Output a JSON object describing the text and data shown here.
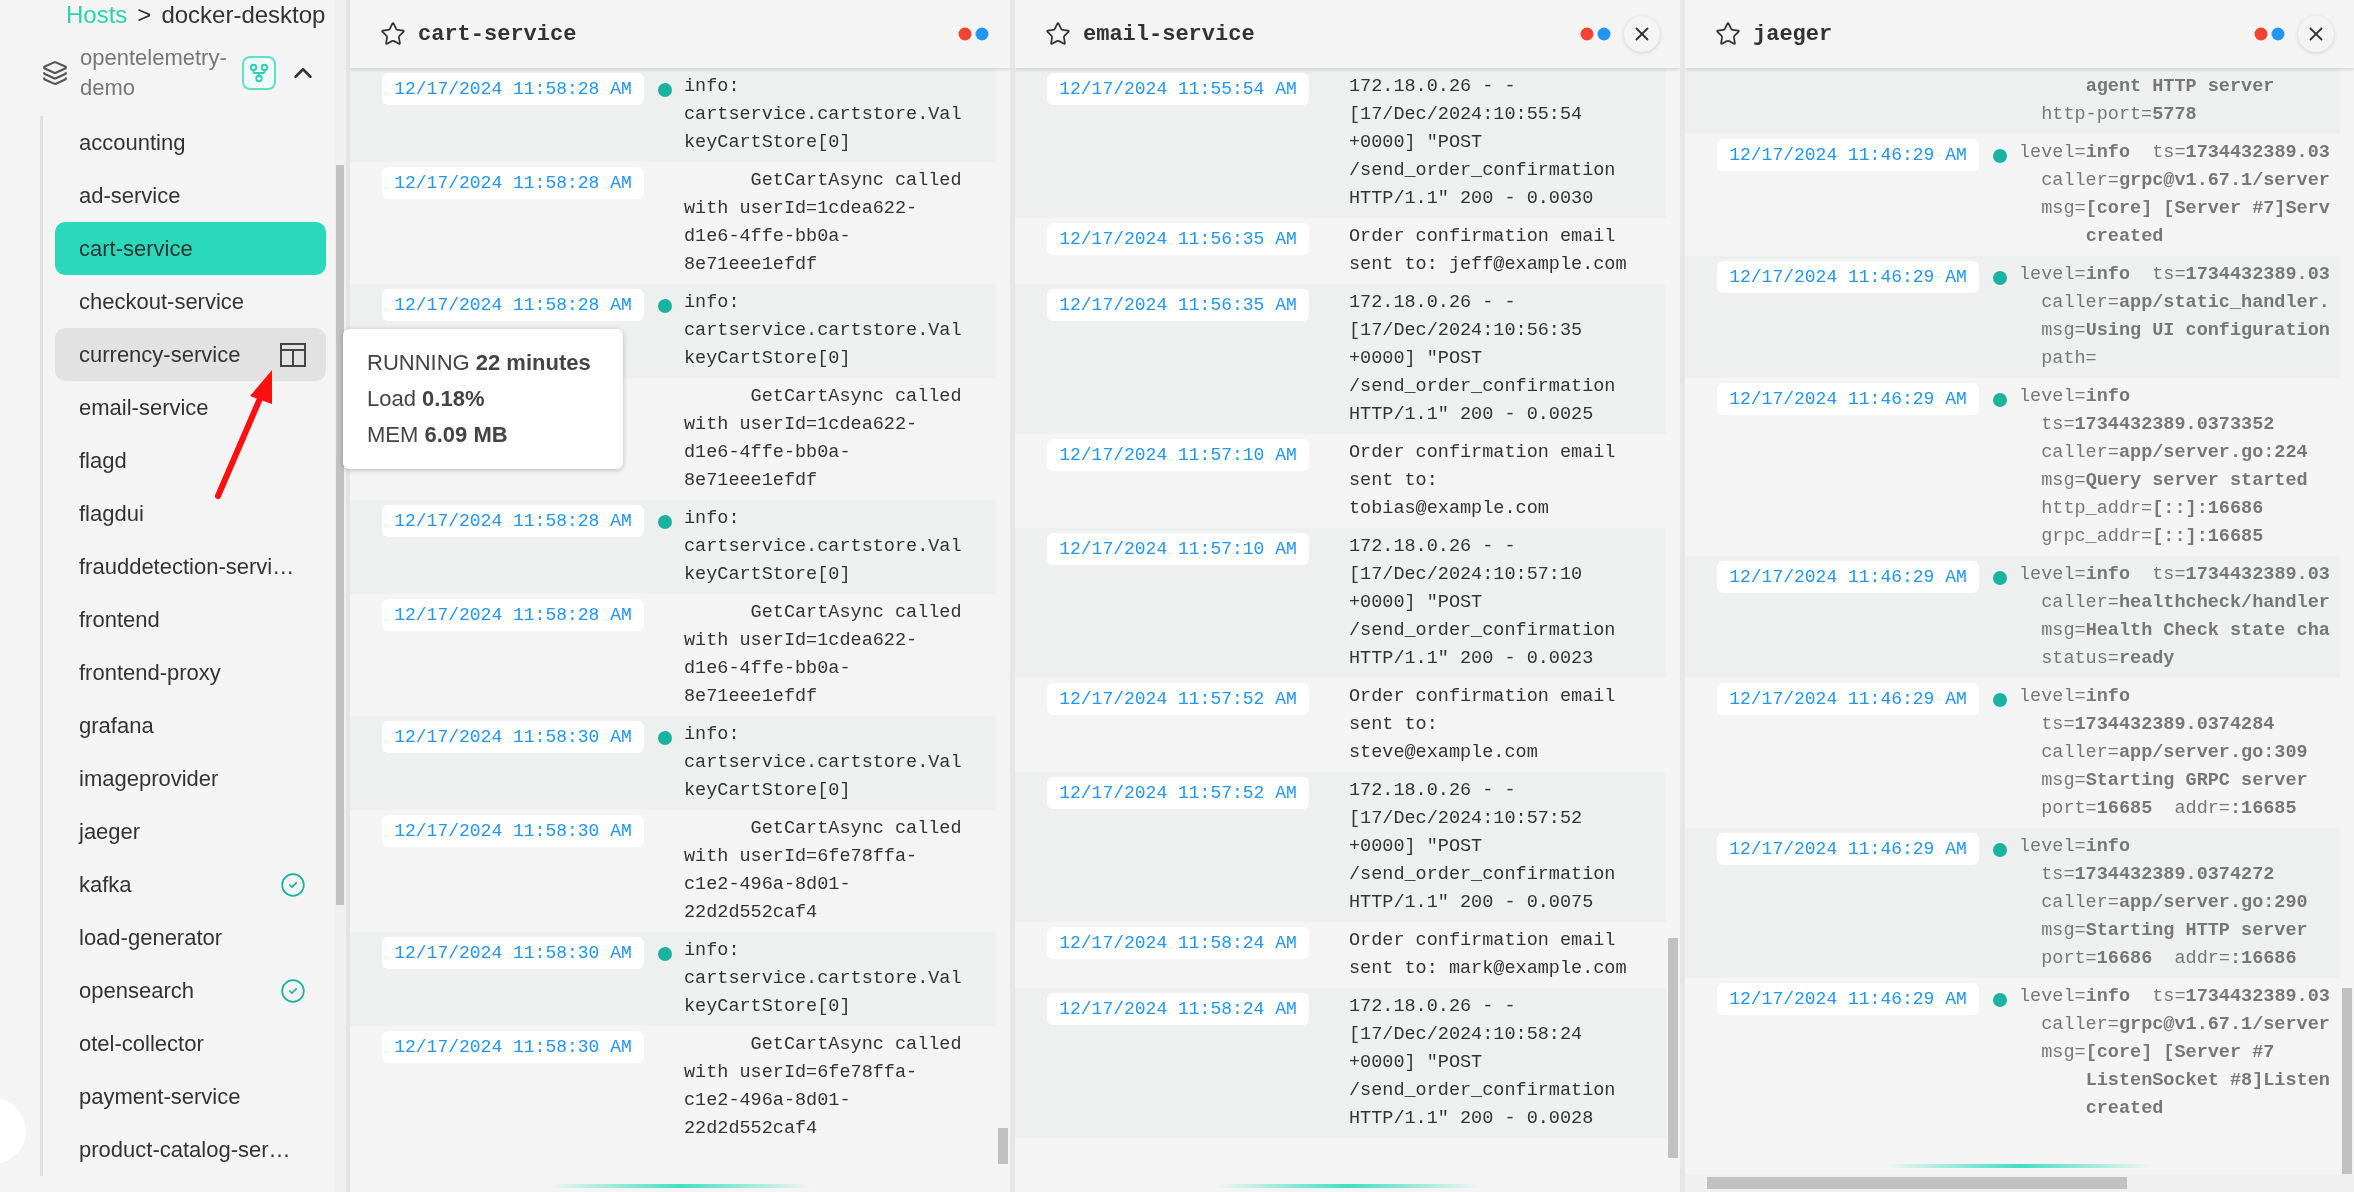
{
  "breadcrumb": {
    "root": "Hosts",
    "separator": ">",
    "current": "docker-desktop"
  },
  "group": {
    "name": "opentelemetry-demo",
    "expanded": true
  },
  "sidebar": {
    "items": [
      {
        "label": "accounting",
        "selected": false,
        "hovered": false,
        "check": false
      },
      {
        "label": "ad-service",
        "selected": false,
        "hovered": false,
        "check": false
      },
      {
        "label": "cart-service",
        "selected": true,
        "hovered": false,
        "check": false
      },
      {
        "label": "checkout-service",
        "selected": false,
        "hovered": false,
        "check": false
      },
      {
        "label": "currency-service",
        "selected": false,
        "hovered": true,
        "check": false
      },
      {
        "label": "email-service",
        "selected": false,
        "hovered": false,
        "check": false
      },
      {
        "label": "flagd",
        "selected": false,
        "hovered": false,
        "check": false
      },
      {
        "label": "flagdui",
        "selected": false,
        "hovered": false,
        "check": false
      },
      {
        "label": "frauddetection-servi…",
        "selected": false,
        "hovered": false,
        "check": false
      },
      {
        "label": "frontend",
        "selected": false,
        "hovered": false,
        "check": false
      },
      {
        "label": "frontend-proxy",
        "selected": false,
        "hovered": false,
        "check": false
      },
      {
        "label": "grafana",
        "selected": false,
        "hovered": false,
        "check": false
      },
      {
        "label": "imageprovider",
        "selected": false,
        "hovered": false,
        "check": false
      },
      {
        "label": "jaeger",
        "selected": false,
        "hovered": false,
        "check": false
      },
      {
        "label": "kafka",
        "selected": false,
        "hovered": false,
        "check": true
      },
      {
        "label": "load-generator",
        "selected": false,
        "hovered": false,
        "check": false
      },
      {
        "label": "opensearch",
        "selected": false,
        "hovered": false,
        "check": true
      },
      {
        "label": "otel-collector",
        "selected": false,
        "hovered": false,
        "check": false
      },
      {
        "label": "payment-service",
        "selected": false,
        "hovered": false,
        "check": false
      },
      {
        "label": "product-catalog-ser…",
        "selected": false,
        "hovered": false,
        "check": false
      }
    ]
  },
  "tooltip": {
    "lines": [
      "RUNNING **22 minutes**",
      "Load **0.18%**",
      "MEM **6.09 MB**"
    ]
  },
  "panels": [
    {
      "title": "cart-service",
      "closable": false,
      "kind": "plain",
      "entries": [
        {
          "time": "12/17/2024 11:58:28 AM",
          "dot": true,
          "lines": [
            "info:",
            "cartservice.cartstore.Val",
            "keyCartStore[0]"
          ]
        },
        {
          "time": "12/17/2024 11:58:28 AM",
          "dot": false,
          "lines": [
            "      GetCartAsync called",
            "with userId=1cdea622-",
            "d1e6-4ffe-bb0a-",
            "8e71eee1efdf"
          ]
        },
        {
          "time": "12/17/2024 11:58:28 AM",
          "dot": true,
          "lines": [
            "info:",
            "cartservice.cartstore.Val",
            "keyCartStore[0]"
          ]
        },
        {
          "dot": false,
          "lines": [
            "      GetCartAsync called",
            "with userId=1cdea622-",
            "d1e6-4ffe-bb0a-",
            "8e71eee1efdf"
          ]
        },
        {
          "time": "12/17/2024 11:58:28 AM",
          "dot": true,
          "lines": [
            "info:",
            "cartservice.cartstore.Val",
            "keyCartStore[0]"
          ]
        },
        {
          "time": "12/17/2024 11:58:28 AM",
          "dot": false,
          "lines": [
            "      GetCartAsync called",
            "with userId=1cdea622-",
            "d1e6-4ffe-bb0a-",
            "8e71eee1efdf"
          ]
        },
        {
          "time": "12/17/2024 11:58:30 AM",
          "dot": true,
          "lines": [
            "info:",
            "cartservice.cartstore.Val",
            "keyCartStore[0]"
          ]
        },
        {
          "time": "12/17/2024 11:58:30 AM",
          "dot": false,
          "lines": [
            "      GetCartAsync called",
            "with userId=6fe78ffa-",
            "c1e2-496a-8d01-",
            "22d2d552caf4"
          ]
        },
        {
          "time": "12/17/2024 11:58:30 AM",
          "dot": true,
          "lines": [
            "info:",
            "cartservice.cartstore.Val",
            "keyCartStore[0]"
          ]
        },
        {
          "time": "12/17/2024 11:58:30 AM",
          "dot": false,
          "lines": [
            "      GetCartAsync called",
            "with userId=6fe78ffa-",
            "c1e2-496a-8d01-",
            "22d2d552caf4"
          ]
        }
      ]
    },
    {
      "title": "email-service",
      "closable": true,
      "kind": "plain",
      "entries": [
        {
          "time": "12/17/2024 11:55:54 AM",
          "dot": false,
          "lines": [
            "172.18.0.26 - -",
            "[17/Dec/2024:10:55:54",
            "+0000] \"POST",
            "/send_order_confirmation",
            "HTTP/1.1\" 200 - 0.0030"
          ]
        },
        {
          "time": "12/17/2024 11:56:35 AM",
          "dot": false,
          "lines": [
            "Order confirmation email",
            "sent to: jeff@example.com"
          ]
        },
        {
          "time": "12/17/2024 11:56:35 AM",
          "dot": false,
          "lines": [
            "172.18.0.26 - -",
            "[17/Dec/2024:10:56:35",
            "+0000] \"POST",
            "/send_order_confirmation",
            "HTTP/1.1\" 200 - 0.0025"
          ]
        },
        {
          "time": "12/17/2024 11:57:10 AM",
          "dot": false,
          "lines": [
            "Order confirmation email",
            "sent to:",
            "tobias@example.com"
          ]
        },
        {
          "time": "12/17/2024 11:57:10 AM",
          "dot": false,
          "lines": [
            "172.18.0.26 - -",
            "[17/Dec/2024:10:57:10",
            "+0000] \"POST",
            "/send_order_confirmation",
            "HTTP/1.1\" 200 - 0.0023"
          ]
        },
        {
          "time": "12/17/2024 11:57:52 AM",
          "dot": false,
          "lines": [
            "Order confirmation email",
            "sent to:",
            "steve@example.com"
          ]
        },
        {
          "time": "12/17/2024 11:57:52 AM",
          "dot": false,
          "lines": [
            "172.18.0.26 - -",
            "[17/Dec/2024:10:57:52",
            "+0000] \"POST",
            "/send_order_confirmation",
            "HTTP/1.1\" 200 - 0.0075"
          ]
        },
        {
          "time": "12/17/2024 11:58:24 AM",
          "dot": false,
          "lines": [
            "Order confirmation email",
            "sent to: mark@example.com"
          ]
        },
        {
          "time": "12/17/2024 11:58:24 AM",
          "dot": false,
          "lines": [
            "172.18.0.26 - -",
            "[17/Dec/2024:10:58:24",
            "+0000] \"POST",
            "/send_order_confirmation",
            "HTTP/1.1\" 200 - 0.0028"
          ]
        }
      ]
    },
    {
      "title": "jaeger",
      "closable": true,
      "kind": "keyvalue",
      "entries": [
        {
          "dot": false,
          "lines": [
            "      **agent HTTP server**",
            "  http-port=**5778**"
          ]
        },
        {
          "time": "12/17/2024 11:46:29 AM",
          "dot": true,
          "lines": [
            "level=**info**  ts=**1734432389.03**",
            "  caller=**grpc@v1.67.1/server**",
            "  msg=**[core] [Server #7]Serv**",
            "      **created**"
          ]
        },
        {
          "time": "12/17/2024 11:46:29 AM",
          "dot": true,
          "lines": [
            "level=**info**  ts=**1734432389.03**",
            "  caller=**app/static_handler.**",
            "  msg=**Using UI configuration**",
            "  path="
          ]
        },
        {
          "time": "12/17/2024 11:46:29 AM",
          "dot": true,
          "lines": [
            "level=**info**",
            "  ts=**1734432389.0373352**",
            "  caller=**app/server.go:224**",
            "  msg=**Query server started**",
            "  http_addr=**[::]:16686**",
            "  grpc_addr=**[::]:16685**"
          ]
        },
        {
          "time": "12/17/2024 11:46:29 AM",
          "dot": true,
          "lines": [
            "level=**info**  ts=**1734432389.03**",
            "  caller=**healthcheck/handler**",
            "  msg=**Health Check state cha**",
            "  status=**ready**"
          ]
        },
        {
          "time": "12/17/2024 11:46:29 AM",
          "dot": true,
          "lines": [
            "level=**info**",
            "  ts=**1734432389.0374284**",
            "  caller=**app/server.go:309**",
            "  msg=**Starting GRPC server**",
            "  port=**16685**  addr=**:16685**"
          ]
        },
        {
          "time": "12/17/2024 11:46:29 AM",
          "dot": true,
          "lines": [
            "level=**info**",
            "  ts=**1734432389.0374272**",
            "  caller=**app/server.go:290**",
            "  msg=**Starting HTTP server**",
            "  port=**16686**  addr=**:16686**"
          ]
        },
        {
          "time": "12/17/2024 11:46:29 AM",
          "dot": true,
          "lines": [
            "level=**info**  ts=**1734432389.03**",
            "  caller=**grpc@v1.67.1/server**",
            "  msg=**[core] [Server #7**",
            "      **ListenSocket #8]Listen**",
            "      **created**"
          ]
        }
      ]
    }
  ]
}
